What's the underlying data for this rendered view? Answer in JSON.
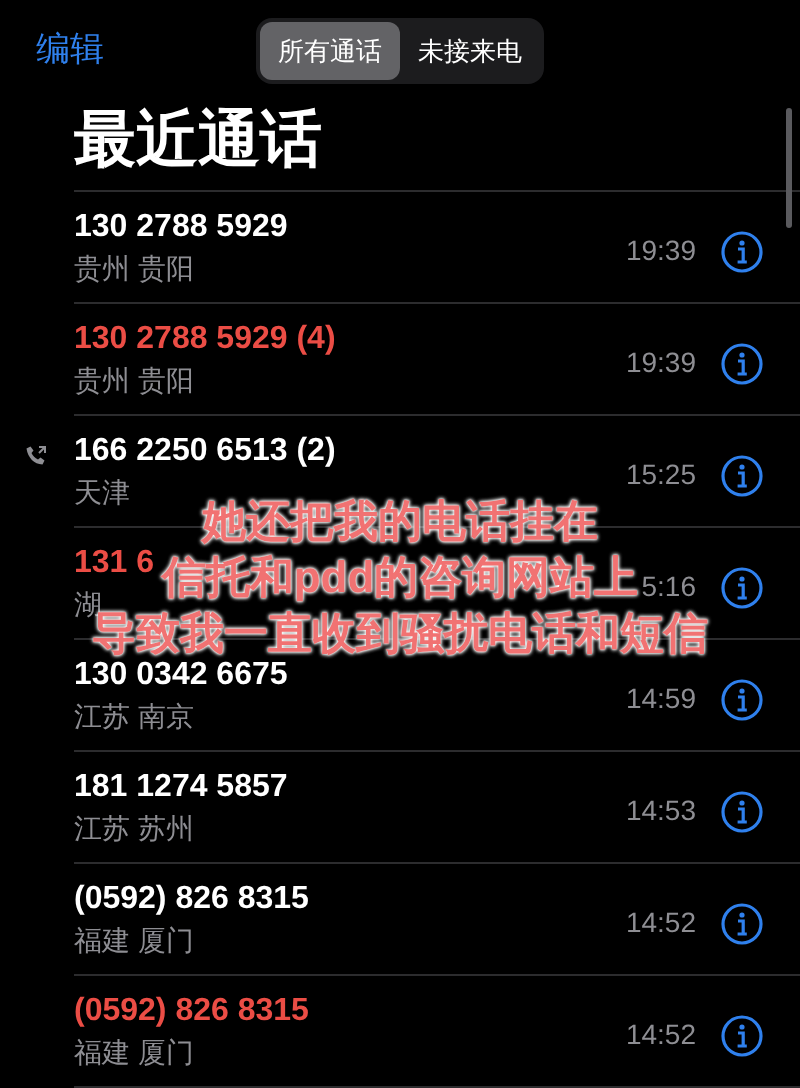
{
  "nav": {
    "edit": "编辑",
    "segments": [
      {
        "label": "所有通话",
        "selected": true
      },
      {
        "label": "未接来电",
        "selected": false
      }
    ]
  },
  "title": "最近通话",
  "calls": [
    {
      "number": "130 2788 5929",
      "location": "贵州 贵阳",
      "time": "19:39",
      "missed": false,
      "outgoing": false
    },
    {
      "number": "130 2788 5929 (4)",
      "location": "贵州 贵阳",
      "time": "19:39",
      "missed": true,
      "outgoing": false
    },
    {
      "number": "166 2250 6513 (2)",
      "location": "天津",
      "time": "15:25",
      "missed": false,
      "outgoing": true
    },
    {
      "number": "131 6",
      "location": "湖",
      "time": "5:16",
      "missed": true,
      "outgoing": false
    },
    {
      "number": "130 0342 6675",
      "location": "江苏 南京",
      "time": "14:59",
      "missed": false,
      "outgoing": false
    },
    {
      "number": "181 1274 5857",
      "location": "江苏 苏州",
      "time": "14:53",
      "missed": false,
      "outgoing": false
    },
    {
      "number": "(0592) 826 8315",
      "location": "福建 厦门",
      "time": "14:52",
      "missed": false,
      "outgoing": false
    },
    {
      "number": "(0592) 826 8315",
      "location": "福建 厦门",
      "time": "14:52",
      "missed": true,
      "outgoing": false
    }
  ],
  "caption": [
    "她还把我的电话挂在",
    "信托和pdd的咨询网站上",
    "导致我一直收到骚扰电话和短信"
  ]
}
